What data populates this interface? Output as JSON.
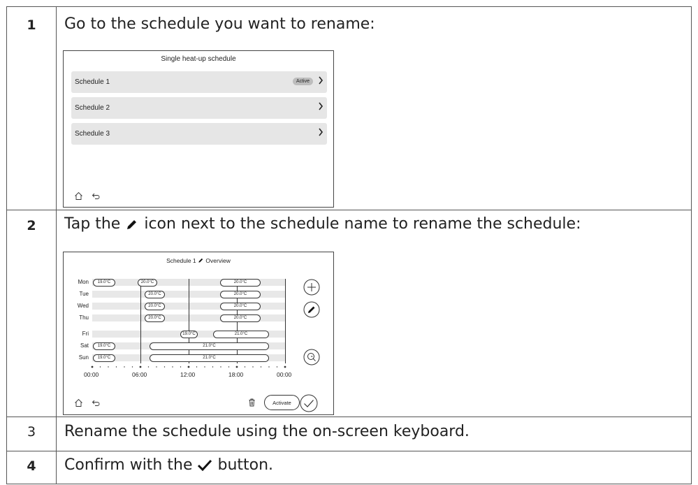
{
  "steps": [
    {
      "number": "1",
      "text": "Go to the schedule you want to rename:"
    },
    {
      "number": "2",
      "text_before": "Tap the",
      "text_after": "icon next to the schedule name to rename the schedule:"
    },
    {
      "number": "3",
      "text": "Rename the schedule using the on-screen keyboard."
    },
    {
      "number": "4",
      "text_before": "Confirm with the",
      "text_after": "button."
    }
  ],
  "screen1": {
    "title": "Single heat-up schedule",
    "rows": [
      {
        "label": "Schedule 1",
        "badge": "Active"
      },
      {
        "label": "Schedule 2"
      },
      {
        "label": "Schedule 3"
      }
    ],
    "icons": [
      "home-icon",
      "back-icon",
      "chevron-right-icon"
    ]
  },
  "screen2": {
    "title_name": "Schedule 1",
    "title_view": "Overview",
    "days": [
      "Mon",
      "Tue",
      "Wed",
      "Thu",
      "Fri",
      "Sat",
      "Sun"
    ],
    "pills": {
      "mon_a": "19.0°C",
      "mon_b": "20.0°C",
      "mon_c": "20.0°C",
      "tue_a": "20.0°C",
      "tue_b": "20.0°C",
      "wed_a": "20.0°C",
      "wed_b": "20.0°C",
      "thu_a": "20.0°C",
      "thu_b": "20.0°C",
      "fri_a": "19.0°C",
      "fri_b": "21.0°C",
      "sat_a": "19.0°C",
      "sat_b": "21.0°C",
      "sun_a": "19.0°C",
      "sun_b": "21.0°C"
    },
    "time_labels": [
      "00:00",
      "06:00",
      "12:00",
      "18:00",
      "00:00"
    ],
    "activate_label": "Activate",
    "icons": [
      "add-icon",
      "edit-icon",
      "zoom-icon",
      "delete-icon",
      "confirm-icon",
      "home-icon",
      "back-icon"
    ]
  }
}
